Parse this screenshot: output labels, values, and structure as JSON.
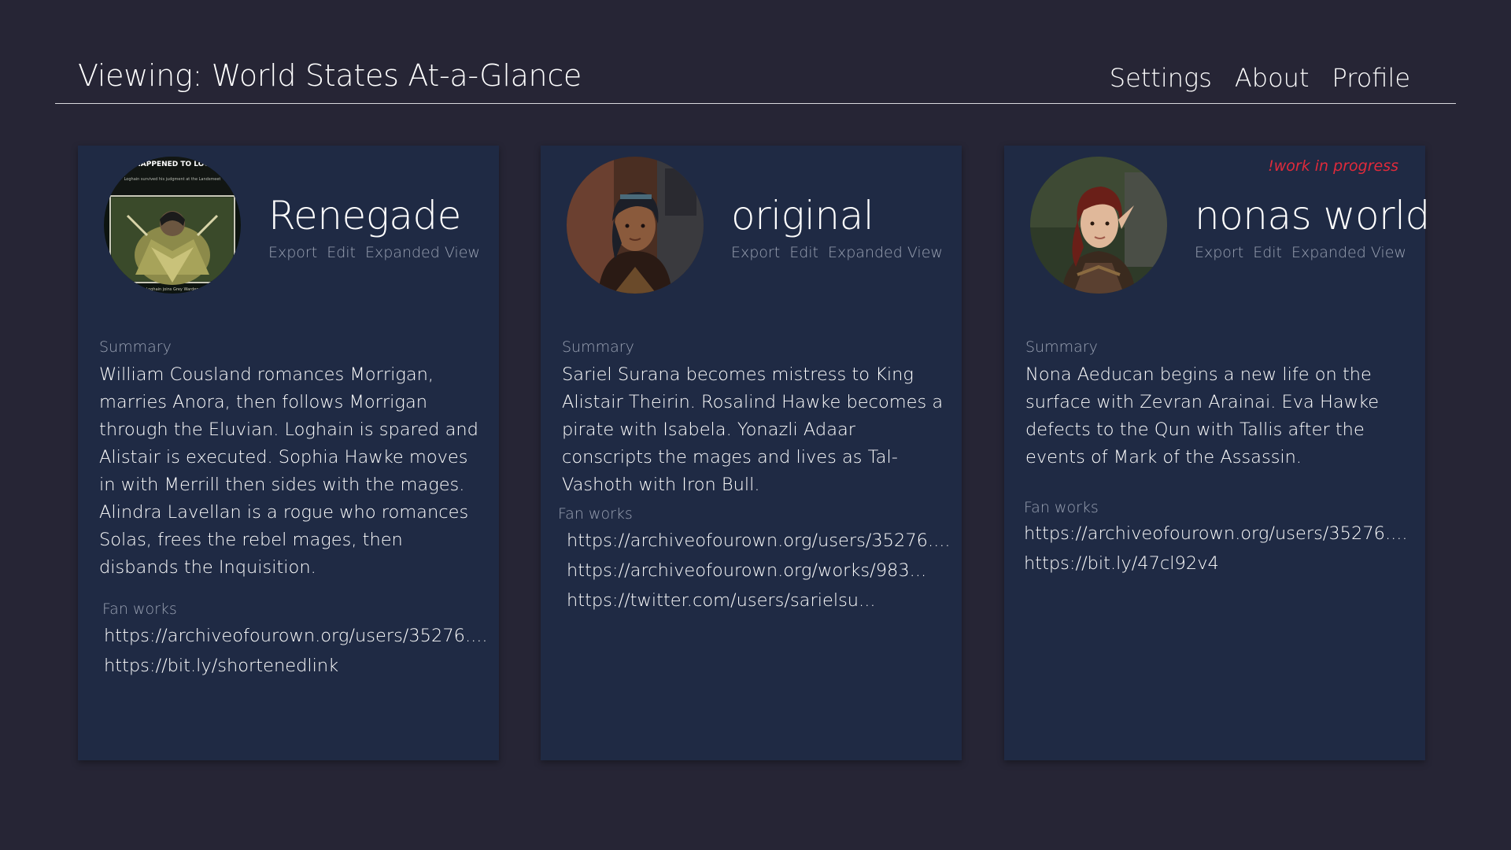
{
  "header": {
    "title": "Viewing: World States At-a-Glance",
    "nav": [
      "Settings",
      "About",
      "Profile"
    ]
  },
  "actions": [
    "Export",
    "Edit",
    "Expanded View"
  ],
  "cards": [
    {
      "name": "Renegade",
      "summary_label": "Summary",
      "summary": "William Cousland romances Morrigan, marries Anora, then follows Morrigan through the Eluvian. Loghain is spared and Alistair is executed. Sophia Hawke moves in with Merrill then sides with the mages. Alindra Lavellan is a rogue who romances Solas, frees the rebel mages, then disbands the Inquisition.",
      "fanworks_label": "Fan works",
      "links": [
        "https://archiveofourown.org/users/35276....",
        "https://bit.ly/shortenedlink"
      ],
      "avatar_caption": "HAPPENED TO LOG",
      "avatar_subtext": "Loghain survived his judgment at the Landsmeet",
      "avatar_footer": "Loghain joins Grey Warden"
    },
    {
      "name": "original",
      "summary_label": "Summary",
      "summary": "Sariel Surana becomes mistress to King Alistair Theirin. Rosalind Hawke becomes a pirate with Isabela. Yonazli Adaar conscripts the mages and lives as Tal-Vashoth with Iron Bull.",
      "fanworks_label": "Fan works",
      "links": [
        "https://archiveofourown.org/users/35276....",
        "https://archiveofourown.org/works/983...",
        "https://twitter.com/users/sarielsu..."
      ]
    },
    {
      "name": "nonas world",
      "badge": "!work in progress",
      "summary_label": "Summary",
      "summary": "Nona Aeducan begins a new life on the surface with Zevran Arainai. Eva Hawke defects to the Qun with Tallis after the events of Mark of the Assassin.",
      "fanworks_label": "Fan works",
      "links": [
        "https://archiveofourown.org/users/35276....",
        "https://bit.ly/47cl92v4"
      ]
    }
  ],
  "colors": {
    "background": "#262535",
    "card": "#1f2a44",
    "muted": "#9aa2b3",
    "badge": "#e02a3b"
  }
}
